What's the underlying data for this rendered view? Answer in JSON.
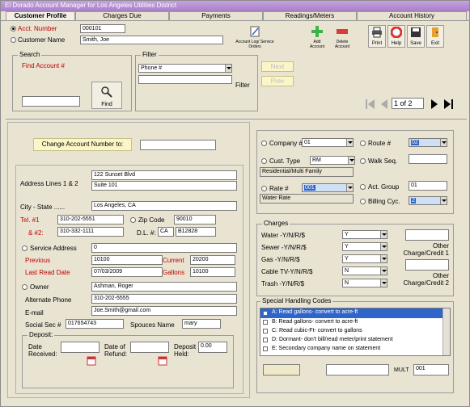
{
  "window": {
    "title": "El Dorado Account Manager for Los Angeles Utilities District"
  },
  "tabs": [
    "Customer Profile",
    "Charges Due",
    "Payments",
    "Readings/Meters",
    "Account History"
  ],
  "account": {
    "acct_label": "Acct. Number",
    "acct_value": "000101",
    "name_label": "Customer Name",
    "name_value": "Smith, Joe",
    "selected_radio": "Acct. Number"
  },
  "toolbar": {
    "log_label": "Account Log/ Service Orders",
    "add_label": "Add Account",
    "delete_label": "Delete Account",
    "print_label": "Print",
    "help_label": "Help",
    "save_label": "Save",
    "exit_label": "Exit"
  },
  "search": {
    "title": "Search",
    "field_label": "Find Account #",
    "find_label": "Find"
  },
  "filter": {
    "title": "Filter",
    "select_value": "Phone #",
    "button_label": "Filter",
    "next_label": "Next",
    "prev_label": "Prev"
  },
  "pager": {
    "page_text": "1 of 2"
  },
  "change_account": {
    "label": "Change Account Number to:"
  },
  "address": {
    "lines_label": "Address Lines 1 & 2",
    "line1": "122 Sunset Blvd",
    "line2": "Suite 101",
    "city_label": "City - State ......",
    "city_value": "Los Angeles, CA",
    "tel1_label": "Tel. #1",
    "tel1_value": "310-202-5551",
    "zip_label": "Zip Code",
    "zip_value": "90010",
    "tel2_label": "& #2:",
    "tel2_value": "310-332-1111",
    "dl_label": "D.L. #:",
    "dl_state": "CA",
    "dl_number": "B12828"
  },
  "service": {
    "address_label": "Service Address",
    "address_value": "0",
    "previous_label": "Previous",
    "previous_value": "10100",
    "current_label": "Current",
    "current_value": "20200",
    "last_read_label": "Last Read Date",
    "last_read_value": "07/03/2009",
    "gallons_label": "Gallons",
    "gallons_value": "10100"
  },
  "owner": {
    "owner_label": "Owner",
    "owner_value": "Ashman, Roger",
    "alt_phone_label": "Alternate Phone",
    "alt_phone_value": "310-202-5555",
    "email_label": "E-mail",
    "email_value": "Joe.Smith@gmail.com",
    "ssn_label": "Social Sec #",
    "ssn_value": "017654743",
    "spouse_label": "Spouces Name",
    "spouse_value": "mary"
  },
  "deposit": {
    "title": "Deposit:",
    "date_received_label": "Date Received:",
    "date_refund_label": "Date of Refund:",
    "held_label": "Deposit Held:",
    "held_value": "0.00"
  },
  "company": {
    "company_label": "Company #",
    "company_value": "01",
    "route_label": "Route #",
    "route_value": "02",
    "cust_type_label": "Cust. Type",
    "cust_type_value": "RM",
    "cust_type_desc": "Residential/Multi Family",
    "walk_label": "Walk Seq.",
    "rate_label": "Rate #",
    "rate_value": "001",
    "rate_desc": "Water Rate",
    "act_group_label": "Act. Group",
    "act_group_value": "01",
    "billing_label": "Billing Cyc.",
    "billing_value": "2"
  },
  "charges": {
    "title": "Charges",
    "rows": [
      {
        "label": "Water -Y/N/R/$",
        "value": "Y"
      },
      {
        "label": "Sewer -Y/N/R/$",
        "value": "Y"
      },
      {
        "label": "Gas -Y/N/R/$",
        "value": "Y"
      },
      {
        "label": "Cable TV-Y/N/R/$",
        "value": "N"
      },
      {
        "label": "Trash -Y/N/R/$",
        "value": "N"
      }
    ],
    "other1": "Other Charge/Credit 1",
    "other2": "Other Charge/Credit 2"
  },
  "special": {
    "title": "Special Handling Codes",
    "items": [
      "A: Read gallons- convert to acre-ft",
      "B: Read gallons- convert to acre-ft",
      "C: Read cubic-Ft- convert to gallons",
      "D: Dormant- don't bill/read meter/print statement",
      "E: Secondary company name on statement"
    ],
    "mult_label": "MULT",
    "mult_value": "001"
  },
  "colors": {
    "title_bar": "#b48ad4",
    "red_label": "#c00000",
    "highlight": "#2f64c8",
    "yellow_field": "#fbf6c8"
  }
}
